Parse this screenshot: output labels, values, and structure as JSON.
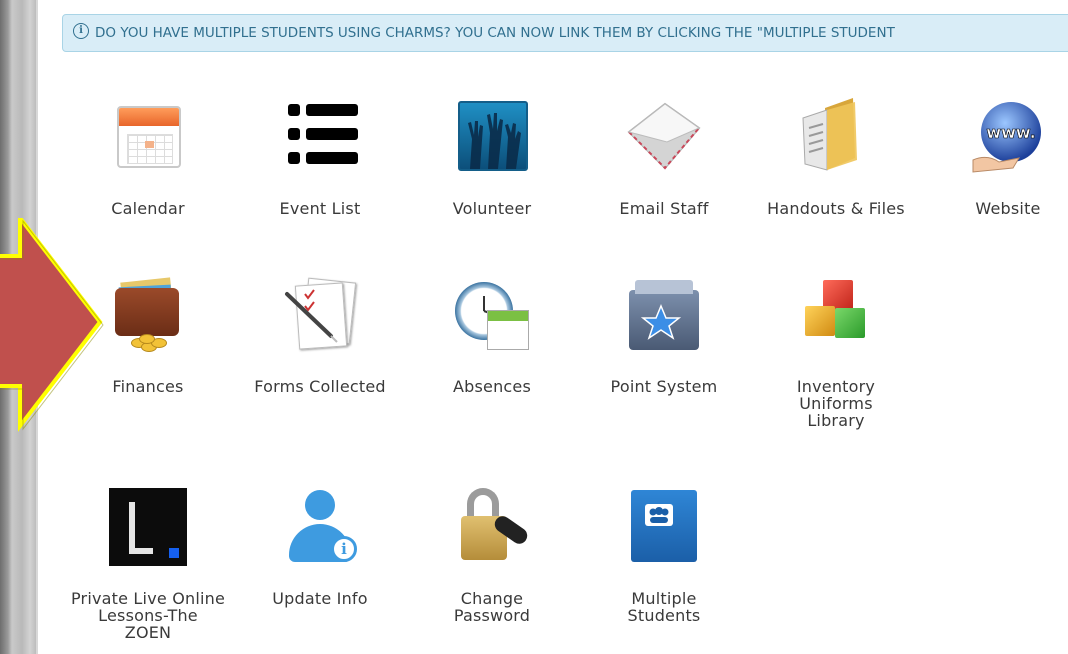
{
  "notice": {
    "text": "DO YOU HAVE MULTIPLE STUDENTS USING CHARMS? YOU CAN NOW LINK THEM BY CLICKING THE \"MULTIPLE STUDENT"
  },
  "tiles": [
    {
      "id": "calendar",
      "label": [
        "Calendar"
      ]
    },
    {
      "id": "event-list",
      "label": [
        "Event List"
      ]
    },
    {
      "id": "volunteer",
      "label": [
        "Volunteer"
      ]
    },
    {
      "id": "email-staff",
      "label": [
        "Email Staff"
      ]
    },
    {
      "id": "handouts-files",
      "label": [
        "Handouts & Files"
      ]
    },
    {
      "id": "website",
      "label": [
        "Website"
      ]
    },
    {
      "id": "finances",
      "label": [
        "Finances"
      ]
    },
    {
      "id": "forms-collected",
      "label": [
        "Forms Collected"
      ]
    },
    {
      "id": "absences",
      "label": [
        "Absences"
      ]
    },
    {
      "id": "point-system",
      "label": [
        "Point System"
      ]
    },
    {
      "id": "inventory",
      "label": [
        "Inventory",
        "Uniforms",
        "Library"
      ]
    },
    {
      "id": "private-lessons",
      "label": [
        "Private Live Online",
        "Lessons-The",
        "ZOEN"
      ]
    },
    {
      "id": "update-info",
      "label": [
        "Update Info"
      ]
    },
    {
      "id": "change-password",
      "label": [
        "Change",
        "Password"
      ]
    },
    {
      "id": "multiple-students",
      "label": [
        "Multiple",
        "Students"
      ]
    }
  ],
  "icons": {
    "website_text": "www.",
    "info_glyph": "i"
  },
  "colors": {
    "notice_bg": "#d9edf7",
    "notice_text": "#31708f",
    "arrow_fill": "#c0504d",
    "arrow_outline": "#ffff00",
    "label_text": "#3a3a3a"
  }
}
